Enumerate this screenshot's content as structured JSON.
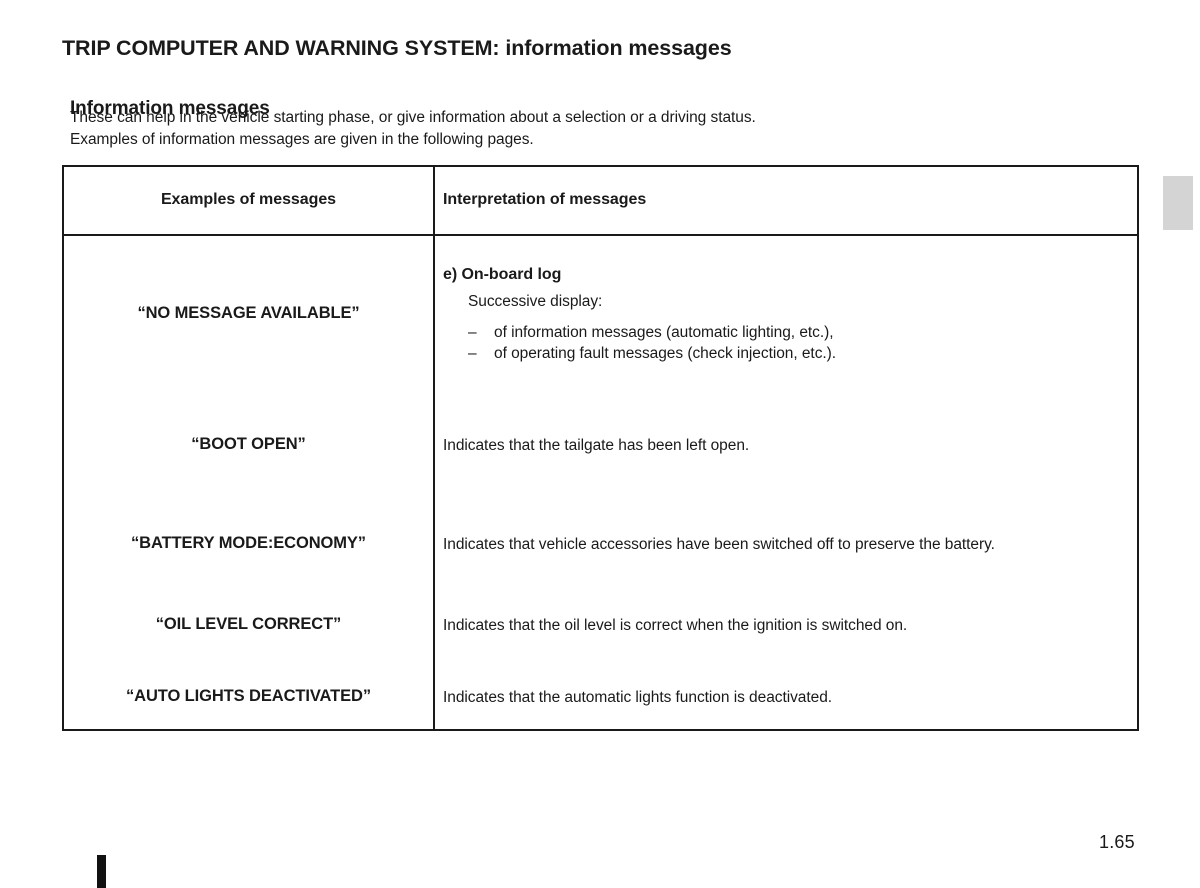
{
  "header": {
    "title_main": "TRIP COMPUTER AND WARNING SYSTEM:",
    "title_sub": " information messages"
  },
  "section": {
    "title": "Information messages",
    "intro_line_1": "These can help in the vehicle starting phase, or give information about a selection or a driving status.",
    "intro_line_2": "Examples of information messages are given in the following pages."
  },
  "table": {
    "columns": [
      "Examples of messages",
      "Interpretation of messages"
    ],
    "rows": [
      {
        "message": "“NO MESSAGE AVAILABLE”",
        "interpretation_title": "e) On-board log",
        "interpretation_sub": "Successive display:",
        "interpretation_items": [
          "of information messages (automatic lighting, etc.),",
          "of operating fault messages (check injection, etc.)."
        ],
        "list_dash": "–"
      },
      {
        "message": "“BOOT OPEN”",
        "interpretation": "Indicates that the tailgate has been left open."
      },
      {
        "message": "“BATTERY MODE:ECONOMY”",
        "interpretation": "Indicates that vehicle accessories have been switched off to preserve the battery."
      },
      {
        "message": "“OIL LEVEL CORRECT”",
        "interpretation": "Indicates that the oil level is correct when the ignition is switched on."
      },
      {
        "message": "“AUTO LIGHTS DEACTIVATED”",
        "interpretation": "Indicates that the automatic lights function is deactivated."
      }
    ]
  },
  "footer": {
    "page_number": "1.65"
  }
}
